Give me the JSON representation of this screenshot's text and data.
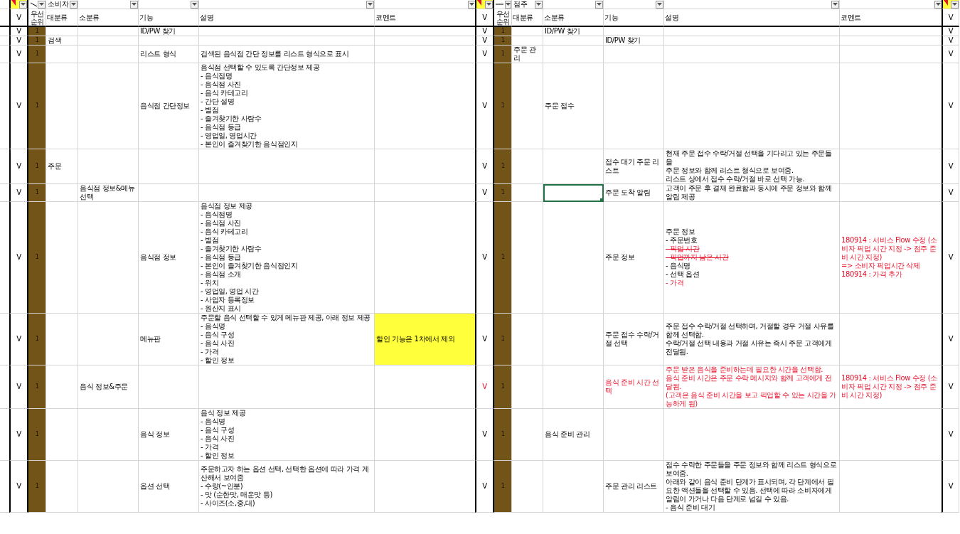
{
  "filter_row": {
    "left_group": "소비자",
    "right_group": "점주"
  },
  "columns": {
    "left": [
      "V",
      "우선순위",
      "대분류",
      "소분류",
      "기능",
      "설명",
      "코멘트"
    ],
    "right": [
      "V",
      "우선순위",
      "대분류",
      "소분류",
      "기능",
      "설명",
      "코멘트",
      "V"
    ]
  },
  "rows": [
    {
      "left": {
        "check": "V",
        "priority": "1",
        "feature": "ID/PW 찾기",
        "changed": false,
        "comment_highlight": false
      },
      "right": {
        "check": "V",
        "priority": "1",
        "minor": "ID/PW 찾기",
        "minor_selected": false,
        "end_check": "V",
        "changed": false,
        "comment_highlight": false
      }
    },
    {
      "left": {
        "check": "V",
        "priority": "1",
        "major": "검색",
        "changed": false,
        "comment_highlight": false
      },
      "right": {
        "check": "V",
        "priority": "1",
        "minor_selected": false,
        "feature": "ID/PW 찾기",
        "end_check": "V",
        "changed": false,
        "comment_highlight": false
      }
    },
    {
      "left": {
        "check": "V",
        "priority": "1",
        "feature": "리스트 형식",
        "desc": [
          {
            "text": "검색된 음식점 간단 정보를 리스트 형식으로 표시",
            "kind": "plain"
          }
        ],
        "changed": false,
        "comment_highlight": false
      },
      "right": {
        "check": "V",
        "priority": "1",
        "major": "주문 관리",
        "minor_selected": false,
        "end_check": "V",
        "changed": false,
        "comment_highlight": false
      }
    },
    {
      "left": {
        "check": "V",
        "priority": "1",
        "feature": "음식점 간단정보",
        "desc": [
          {
            "text": "음식점 선택할 수 있도록 간단정보 제공",
            "kind": "plain"
          },
          {
            "text": "- 음식점명",
            "kind": "plain"
          },
          {
            "text": "- 음식점 사진",
            "kind": "plain"
          },
          {
            "text": "- 음식 카테고리",
            "kind": "plain"
          },
          {
            "text": "- 간단 설명",
            "kind": "plain"
          },
          {
            "text": "- 별점",
            "kind": "plain"
          },
          {
            "text": "- 즐겨찾기한 사람수",
            "kind": "plain"
          },
          {
            "text": "- 음식점 등급",
            "kind": "plain"
          },
          {
            "text": "- 영업일, 영업시간",
            "kind": "plain"
          },
          {
            "text": "- 본인이 즐겨찾기한 음식점인지",
            "kind": "plain"
          }
        ],
        "changed": false,
        "comment_highlight": false
      },
      "right": {
        "check": "V",
        "priority": "1",
        "minor": "주문 접수",
        "minor_selected": false,
        "end_check": "V",
        "changed": false,
        "comment_highlight": false
      }
    },
    {
      "left": {
        "check": "V",
        "priority": "1",
        "major": "주문",
        "changed": false,
        "comment_highlight": false
      },
      "right": {
        "check": "V",
        "priority": "1",
        "minor_selected": false,
        "feature": "접수 대기 주문 리스트",
        "desc": [
          {
            "text": "현재 주문 접수 수락/거절 선택을 기다리고 있는 주문들을",
            "kind": "plain"
          },
          {
            "text": "주문 정보와 함께 리스트 형식으로 보여줌.",
            "kind": "plain"
          },
          {
            "text": "리스트 상에서 접수 수락/거절 바로 선택 가능.",
            "kind": "plain"
          }
        ],
        "end_check": "V",
        "changed": false,
        "comment_highlight": false
      }
    },
    {
      "left": {
        "check": "V",
        "priority": "1",
        "minor": "음식점 정보&메뉴 선택",
        "changed": false,
        "comment_highlight": false
      },
      "right": {
        "check": "V",
        "priority": "1",
        "minor_selected": true,
        "feature": "주문 도착 알림",
        "desc": [
          {
            "text": "고객이 주문 후 결재 완료함과 동시에 주문 정보와 함께 알림 제공",
            "kind": "plain"
          }
        ],
        "end_check": "V",
        "changed": false,
        "comment_highlight": false
      }
    },
    {
      "left": {
        "check": "V",
        "priority": "1",
        "feature": "음식점 정보",
        "desc": [
          {
            "text": "음식점 정보 제공",
            "kind": "plain"
          },
          {
            "text": "- 음식점명",
            "kind": "plain"
          },
          {
            "text": "- 음식점 사진",
            "kind": "plain"
          },
          {
            "text": "- 음식 카테고리",
            "kind": "plain"
          },
          {
            "text": "- 별점",
            "kind": "plain"
          },
          {
            "text": "- 즐겨찾기한 사람수",
            "kind": "plain"
          },
          {
            "text": "- 음식점 등급",
            "kind": "plain"
          },
          {
            "text": "- 본인이 즐겨찾기한 음식점인지",
            "kind": "plain"
          },
          {
            "text": "- 음식점 소개",
            "kind": "plain"
          },
          {
            "text": "- 위치",
            "kind": "plain"
          },
          {
            "text": "- 영업일, 영업 시간",
            "kind": "plain"
          },
          {
            "text": "- 사업자 등록정보",
            "kind": "plain"
          },
          {
            "text": "- 원산지 표시",
            "kind": "plain"
          }
        ],
        "changed": false,
        "comment_highlight": false
      },
      "right": {
        "check": "V",
        "priority": "1",
        "minor_selected": false,
        "feature": "주문 정보",
        "desc": [
          {
            "text": "주문 정보",
            "kind": "plain"
          },
          {
            "text": "- 주문번호",
            "kind": "plain"
          },
          {
            "text": "- 픽업 시간",
            "kind": "struck"
          },
          {
            "text": "- 픽업까지 남은 시간",
            "kind": "struck"
          },
          {
            "text": "- 음식명",
            "kind": "plain"
          },
          {
            "text": "- 선택 옵션",
            "kind": "plain"
          },
          {
            "text": "- 가격",
            "kind": "added"
          }
        ],
        "comment": [
          {
            "text": "180914 : 서비스 Flow 수정 (소비자 픽업 시간 지정 -> 점주 준비 시간 지정)",
            "kind": "added"
          },
          {
            "text": "=> 소비자 픽업시간 삭제",
            "kind": "added"
          },
          {
            "text": "180914 : 가격 추가",
            "kind": "added"
          }
        ],
        "end_check": "V",
        "changed": false,
        "comment_highlight": false
      }
    },
    {
      "left": {
        "check": "V",
        "priority": "1",
        "feature": "메뉴판",
        "desc": [
          {
            "text": "주문할 음식 선택할 수 있게 메뉴판 제공, 아래 정보 제공",
            "kind": "plain"
          },
          {
            "text": "- 음식명",
            "kind": "plain"
          },
          {
            "text": "- 음식 구성",
            "kind": "plain"
          },
          {
            "text": "- 음식 사진",
            "kind": "plain"
          },
          {
            "text": "- 가격",
            "kind": "plain"
          },
          {
            "text": "- 할인 정보",
            "kind": "plain"
          }
        ],
        "comment": [
          {
            "text": "할인 기능은 1차에서 제외",
            "kind": "plain"
          }
        ],
        "changed": false,
        "comment_highlight": true
      },
      "right": {
        "check": "V",
        "priority": "1",
        "minor_selected": false,
        "feature": "주문 접수 수락/거절 선택",
        "desc": [
          {
            "text": "주문 접수 수락/거절 선택하며, 거절할 경우 거절 사유를 함께 선택함.",
            "kind": "plain"
          },
          {
            "text": "수락/거절 선택 내용과 거절 사유는 즉시 주문 고객에게 전달됨.",
            "kind": "plain"
          }
        ],
        "end_check": "V",
        "changed": false,
        "comment_highlight": false
      }
    },
    {
      "left": {
        "check": "V",
        "priority": "1",
        "minor": "음식 정보&주문",
        "changed": false,
        "comment_highlight": false
      },
      "right": {
        "check": "V",
        "priority": "1",
        "minor_selected": false,
        "feature": "음식 준비 시간 선택",
        "desc": [
          {
            "text": "주문 받은 음식을 준비하는데 필요한 시간을 선택함.",
            "kind": "added"
          },
          {
            "text": "음식 준비 시간은 주문 수락 메시지와 함께 고객에게 전달됨.",
            "kind": "added"
          },
          {
            "text": "(고객은 음식 준비 시간을 보고 픽업할 수 있는 시간을 가능하게 됨)",
            "kind": "added"
          }
        ],
        "comment": [
          {
            "text": "180914 : 서비스 Flow 수정 (소비자 픽업 시간 지정 -> 점주 준비 시간 지정)",
            "kind": "added"
          }
        ],
        "end_check": "V",
        "changed": true,
        "comment_highlight": false
      }
    },
    {
      "left": {
        "check": "V",
        "priority": "1",
        "feature": "음식 정보",
        "desc": [
          {
            "text": "음식 정보 제공",
            "kind": "plain"
          },
          {
            "text": "- 음식명",
            "kind": "plain"
          },
          {
            "text": "- 음식 구성",
            "kind": "plain"
          },
          {
            "text": "- 음식 사진",
            "kind": "plain"
          },
          {
            "text": "- 가격",
            "kind": "plain"
          },
          {
            "text": "- 할인 정보",
            "kind": "plain"
          }
        ],
        "changed": false,
        "comment_highlight": false
      },
      "right": {
        "check": "V",
        "priority": "1",
        "minor": "음식 준비 관리",
        "minor_selected": false,
        "end_check": "V",
        "changed": false,
        "comment_highlight": false
      }
    },
    {
      "left": {
        "check": "V",
        "priority": "1",
        "feature": "옵션 선택",
        "desc": [
          {
            "text": "주문하고자 하는 옵션 선택, 선택한 옵션에 따라 가격 계산해서 보여줌",
            "kind": "plain"
          },
          {
            "text": "- 수량(~인분)",
            "kind": "plain"
          },
          {
            "text": "- 맛 (순한맛, 매운맛 등)",
            "kind": "plain"
          },
          {
            "text": "- 사이즈(소,중,대)",
            "kind": "plain"
          }
        ],
        "changed": false,
        "comment_highlight": false
      },
      "right": {
        "check": "V",
        "priority": "1",
        "minor_selected": false,
        "feature": "주문 관리 리스트",
        "desc": [
          {
            "text": "접수 수락한 주문들을 주문 정보와 함께 리스트 형식으로 보여줌.",
            "kind": "plain"
          },
          {
            "text": "아래와 같이 음식 준비 단계가 표시되며, 각 단계에서 필요한 액션들을 선택할 수 있음. 선택에 따라 소비자에게 알림이 가거나 다음 단계로 넘길 수 있음.",
            "kind": "plain"
          },
          {
            "text": "- 음식 준비 대기",
            "kind": "plain"
          }
        ],
        "end_check": "V",
        "changed": false,
        "comment_highlight": false
      }
    }
  ]
}
